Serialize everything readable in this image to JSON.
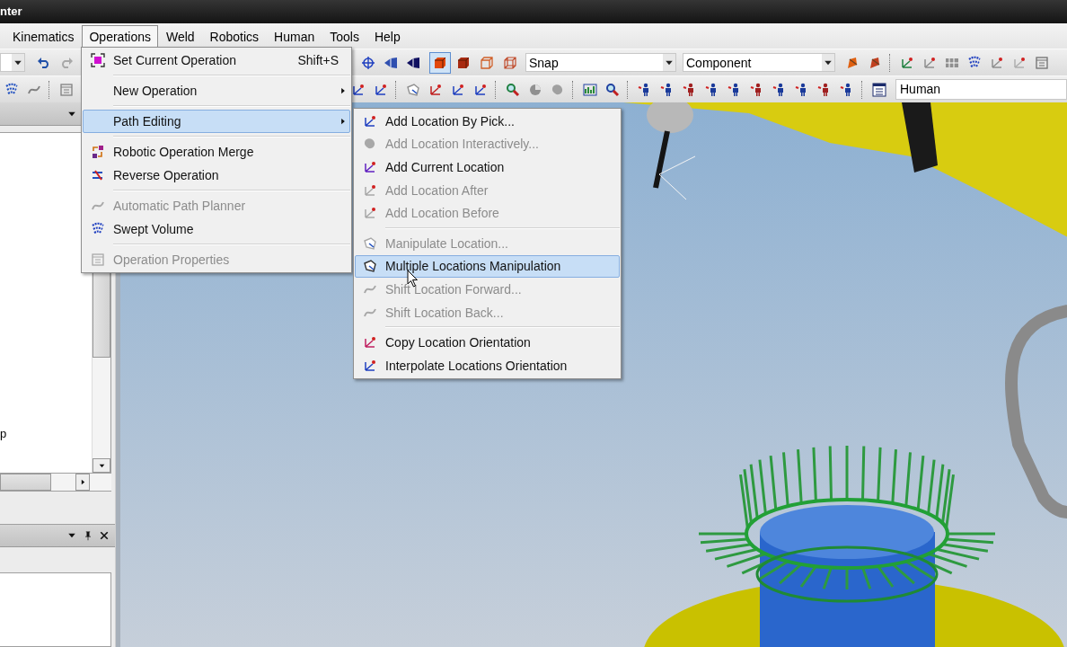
{
  "title_bar": {
    "title": "nter"
  },
  "menu_bar": [
    {
      "label": "Kinematics",
      "selected": false
    },
    {
      "label": "Operations",
      "selected": true
    },
    {
      "label": "Weld",
      "selected": false
    },
    {
      "label": "Robotics",
      "selected": false
    },
    {
      "label": "Human",
      "selected": false
    },
    {
      "label": "Tools",
      "selected": false
    },
    {
      "label": "Help",
      "selected": false
    }
  ],
  "toolbar": {
    "render_mode_buttons": [
      {
        "selected": true
      },
      {
        "selected": false
      },
      {
        "selected": false
      },
      {
        "selected": false
      }
    ],
    "snap_dropdown": {
      "value": "Snap"
    },
    "pick_dropdown": {
      "value": "Component"
    },
    "human_field": {
      "value": "Human"
    }
  },
  "object_tree": {
    "texts": [
      "p"
    ]
  },
  "operations_menu": {
    "items": [
      {
        "kind": "icon_item",
        "label": "Set Current Operation",
        "shortcut": "Shift+S",
        "submenu": false,
        "disabled": false,
        "selected": false
      },
      {
        "kind": "separator"
      },
      {
        "kind": "text_item",
        "label": "New Operation",
        "submenu": true,
        "disabled": false,
        "selected": false
      },
      {
        "kind": "separator"
      },
      {
        "kind": "text_item",
        "label": "Path Editing",
        "submenu": true,
        "disabled": false,
        "selected": true
      },
      {
        "kind": "separator"
      },
      {
        "kind": "icon_item",
        "label": "Robotic Operation Merge",
        "submenu": false,
        "disabled": false,
        "selected": false
      },
      {
        "kind": "icon_item",
        "label": "Reverse Operation",
        "submenu": false,
        "disabled": false,
        "selected": false
      },
      {
        "kind": "separator"
      },
      {
        "kind": "icon_item",
        "label": "Automatic Path Planner",
        "submenu": false,
        "disabled": true,
        "selected": false
      },
      {
        "kind": "icon_item",
        "label": "Swept Volume",
        "submenu": false,
        "disabled": false,
        "selected": false
      },
      {
        "kind": "separator"
      },
      {
        "kind": "icon_item",
        "label": "Operation Properties",
        "submenu": false,
        "disabled": true,
        "selected": false
      }
    ]
  },
  "path_editing_menu": {
    "items": [
      {
        "kind": "icon_item",
        "label": "Add Location By Pick...",
        "disabled": false,
        "selected": false
      },
      {
        "kind": "icon_item",
        "label": "Add Location Interactively...",
        "disabled": true,
        "selected": false
      },
      {
        "kind": "icon_item",
        "label": "Add Current Location",
        "disabled": false,
        "selected": false
      },
      {
        "kind": "icon_item",
        "label": "Add Location After",
        "disabled": true,
        "selected": false
      },
      {
        "kind": "icon_item",
        "label": "Add Location Before",
        "disabled": true,
        "selected": false
      },
      {
        "kind": "separator"
      },
      {
        "kind": "icon_item",
        "label": "Manipulate Location...",
        "disabled": true,
        "selected": false
      },
      {
        "kind": "icon_item",
        "label": "Multiple Locations Manipulation",
        "disabled": false,
        "selected": true
      },
      {
        "kind": "icon_item",
        "label": "Shift Location Forward...",
        "disabled": true,
        "selected": false
      },
      {
        "kind": "icon_item",
        "label": "Shift Location Back...",
        "disabled": true,
        "selected": false
      },
      {
        "kind": "separator"
      },
      {
        "kind": "icon_item",
        "label": "Copy Location Orientation",
        "disabled": false,
        "selected": false
      },
      {
        "kind": "icon_item",
        "label": "Interpolate Locations Orientation",
        "disabled": false,
        "selected": false
      }
    ]
  }
}
